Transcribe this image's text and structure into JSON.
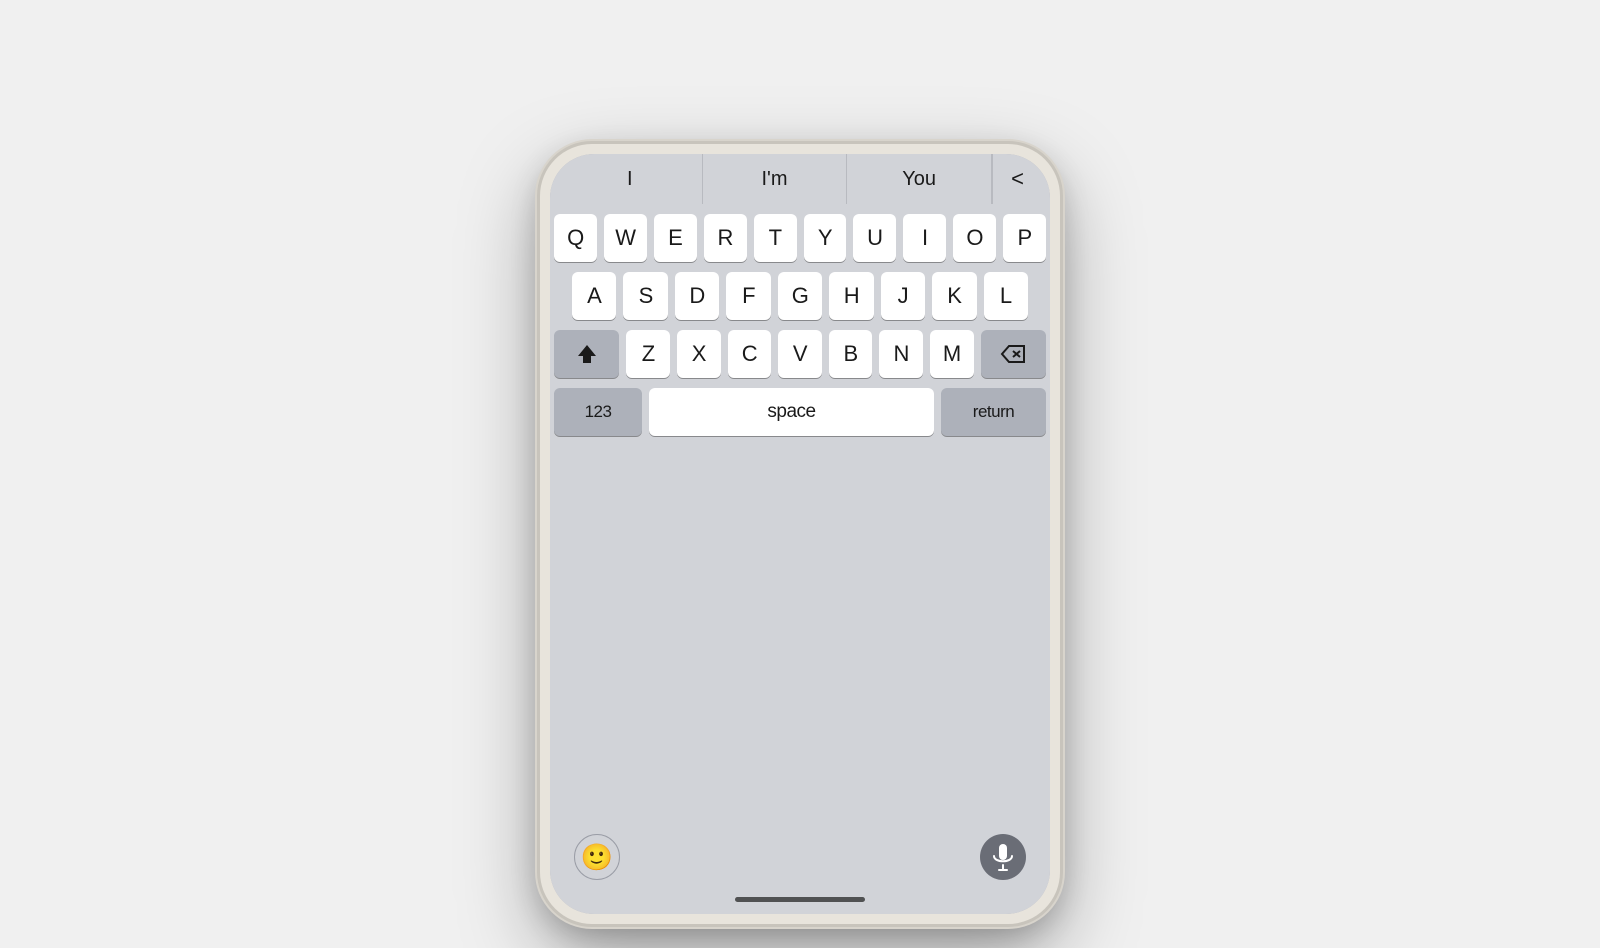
{
  "page": {
    "background_color": "#f0f0f0"
  },
  "predictive": {
    "suggestions": [
      "I",
      "I'm",
      "You"
    ],
    "back_icon": "<"
  },
  "keyboard": {
    "row1": [
      "Q",
      "W",
      "E",
      "R",
      "T",
      "Y",
      "U",
      "I",
      "O",
      "P"
    ],
    "row2": [
      "A",
      "S",
      "D",
      "F",
      "G",
      "H",
      "J",
      "K",
      "L"
    ],
    "row3_letters": [
      "Z",
      "X",
      "C",
      "V",
      "B",
      "N",
      "M"
    ],
    "bottom_left": "123",
    "space": "space",
    "return": "return"
  },
  "bottom": {
    "emoji_label": "😀",
    "mic_label": "microphone"
  }
}
